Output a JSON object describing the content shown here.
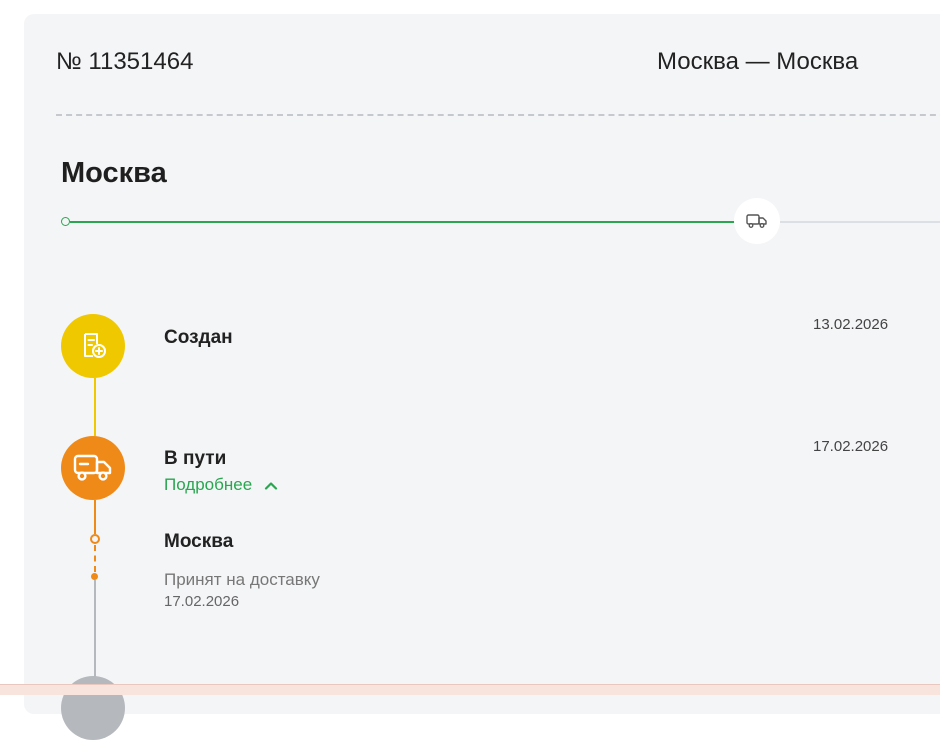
{
  "order": {
    "number": "№ 11351464",
    "route": "Москва — Москва"
  },
  "current_city": "Москва",
  "colors": {
    "accent_green": "#2aa650",
    "created_yellow": "#f0c800",
    "transit_orange": "#ef8a19",
    "pending_gray": "#b5b8bd"
  },
  "progress": {
    "fraction_complete": 0.78
  },
  "stages": {
    "created": {
      "title": "Создан",
      "date": "13.02.2026",
      "icon": "document-plus-icon"
    },
    "in_transit": {
      "title": "В пути",
      "date": "17.02.2026",
      "icon": "truck-icon",
      "details_link": "Подробнее",
      "details": {
        "city": "Москва",
        "status": "Принят на доставку",
        "date": "17.02.2026"
      }
    }
  }
}
